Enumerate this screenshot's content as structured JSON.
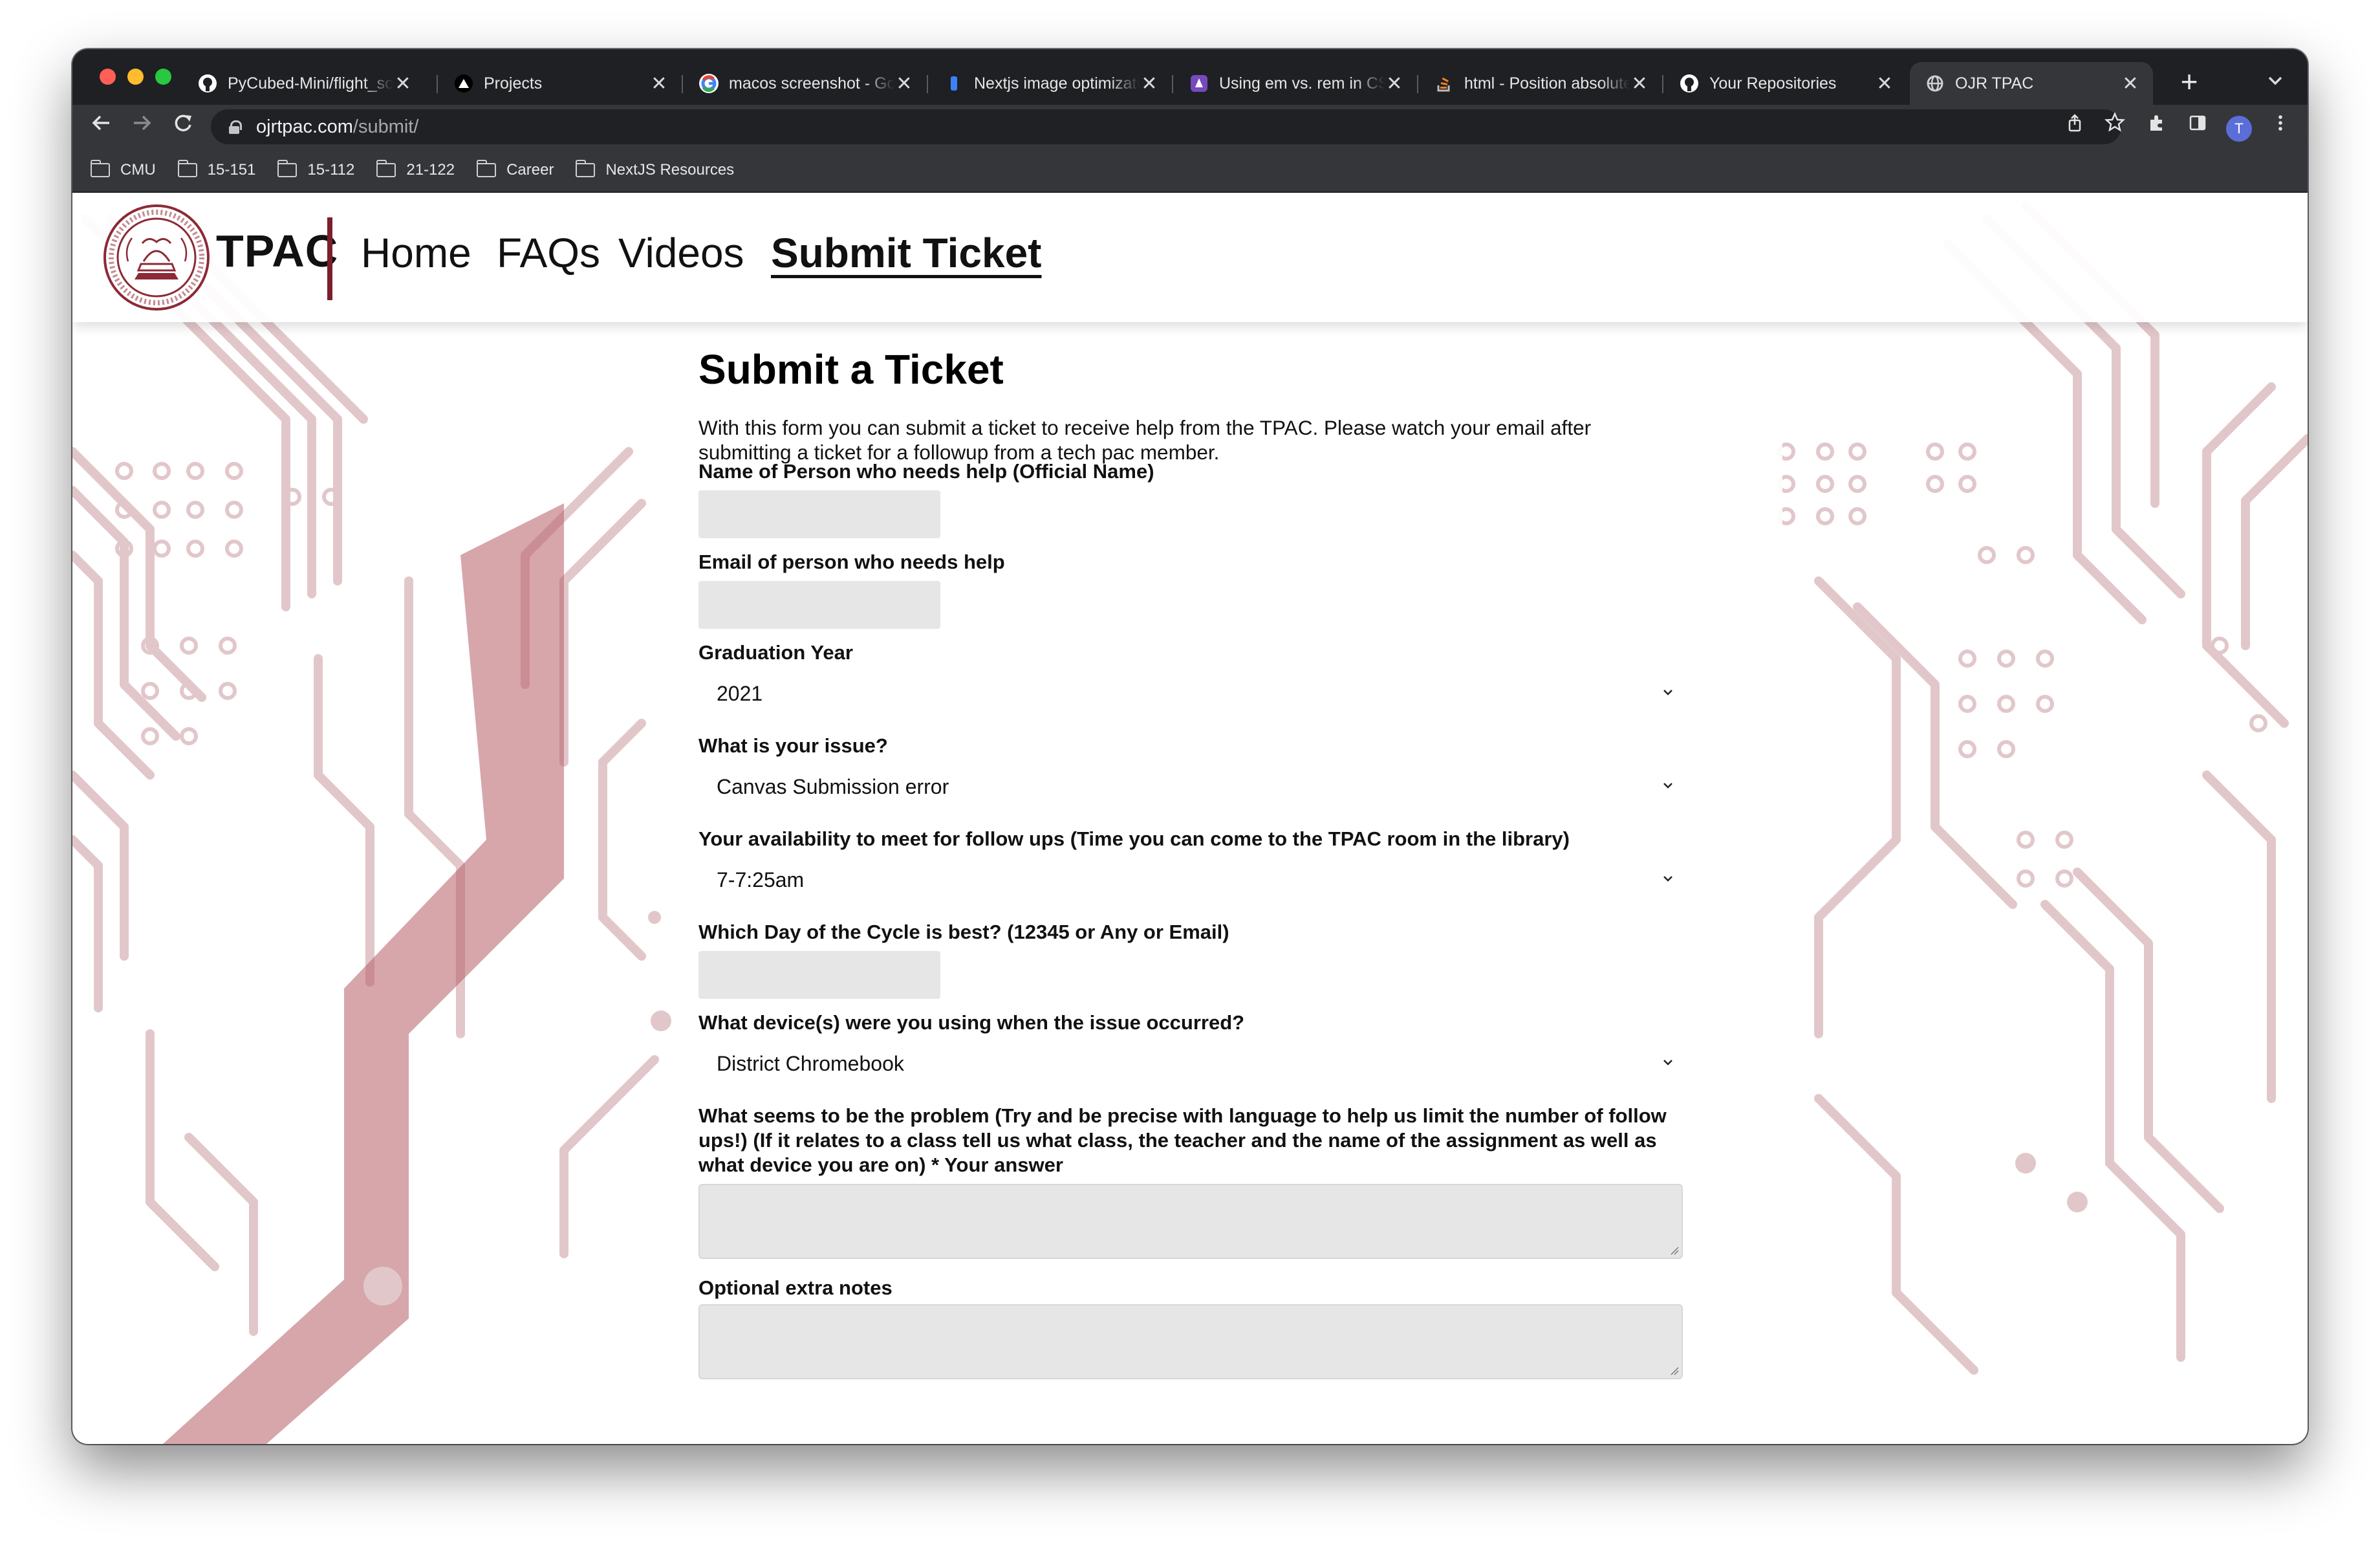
{
  "browser": {
    "tabs": [
      {
        "title": "PyCubed-Mini/flight_software",
        "icon": "github-icon"
      },
      {
        "title": "Projects",
        "icon": "vercel-icon"
      },
      {
        "title": "macos screenshot - Google Search",
        "icon": "google-icon"
      },
      {
        "title": "Nextjs image optimization",
        "icon": "bookmark-icon"
      },
      {
        "title": "Using em vs. rem in CSS",
        "icon": "logrocket-icon"
      },
      {
        "title": "html - Position absolute",
        "icon": "stackoverflow-icon"
      },
      {
        "title": "Your Repositories",
        "icon": "github-icon"
      },
      {
        "title": "OJR TPAC",
        "icon": "globe-icon"
      }
    ],
    "active_tab": 7,
    "url_host": "ojrtpac.com",
    "url_path": "/submit/",
    "profile_initial": "T",
    "bookmarks": [
      "CMU",
      "15-151",
      "15-112",
      "21-122",
      "Career",
      "NextJS Resources"
    ]
  },
  "site": {
    "brand": "TPAC",
    "nav": [
      {
        "label": "Home",
        "current": false
      },
      {
        "label": "FAQs",
        "current": false
      },
      {
        "label": "Videos",
        "current": false
      },
      {
        "label": "Submit Ticket",
        "current": true
      }
    ],
    "accent_color": "#7a1f2b"
  },
  "form": {
    "title": "Submit a Ticket",
    "intro": "With this form you can submit a ticket to receive help from the TPAC. Please watch your email after submitting a ticket for a followup from a tech pac member.",
    "fields": {
      "name": {
        "label": "Name of Person who needs help (Official Name)",
        "value": ""
      },
      "email": {
        "label": "Email of person who needs help",
        "value": ""
      },
      "grad_year": {
        "label": "Graduation Year",
        "value": "2021"
      },
      "issue": {
        "label": "What is your issue?",
        "value": "Canvas Submission error"
      },
      "availability": {
        "label": "Your availability to meet for follow ups (Time you can come to the TPAC room in the library)",
        "value": "7-7:25am"
      },
      "cycle_day": {
        "label": "Which Day of the Cycle is best? (12345 or Any or Email)",
        "value": ""
      },
      "device": {
        "label": "What device(s) were you using when the issue occurred?",
        "value": "District Chromebook"
      },
      "problem": {
        "label": "What seems to be the problem (Try and be precise with language to help us limit the number of follow ups!) (If it relates to a class tell us what class, the teacher and the name of the assignment as well as what device you are on) * Your answer",
        "value": ""
      },
      "notes": {
        "label": "Optional extra notes",
        "value": ""
      }
    }
  }
}
